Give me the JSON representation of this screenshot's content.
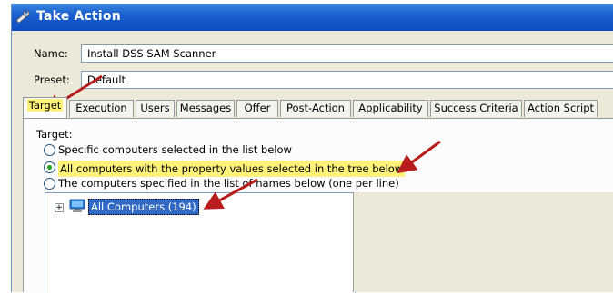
{
  "window": {
    "title": "Take Action",
    "title_icon": "wrench-icon"
  },
  "form": {
    "name_label": "Name:",
    "name_value": "Install DSS SAM Scanner",
    "preset_label": "Preset:",
    "preset_value": "Default"
  },
  "tabs": [
    {
      "label": "Target",
      "active": true
    },
    {
      "label": "Execution"
    },
    {
      "label": "Users"
    },
    {
      "label": "Messages"
    },
    {
      "label": "Offer"
    },
    {
      "label": "Post-Action"
    },
    {
      "label": "Applicability"
    },
    {
      "label": "Success Criteria"
    },
    {
      "label": "Action Script"
    }
  ],
  "target": {
    "label": "Target:",
    "options": [
      {
        "label": "Specific computers selected in the list below",
        "checked": false
      },
      {
        "label": "All computers with the property values selected in the tree below",
        "checked": true
      },
      {
        "label": "The computers specified in the list of names below (one per line)",
        "checked": false
      }
    ],
    "tree": {
      "root_label": "All Computers (194)",
      "root_icon": "computer-monitor-icon",
      "expander": "+"
    }
  },
  "colors": {
    "highlight": "#fff27a",
    "arrow": "#b81c1c",
    "selection": "#316ac5",
    "titlebar": "#0c4bc0"
  }
}
